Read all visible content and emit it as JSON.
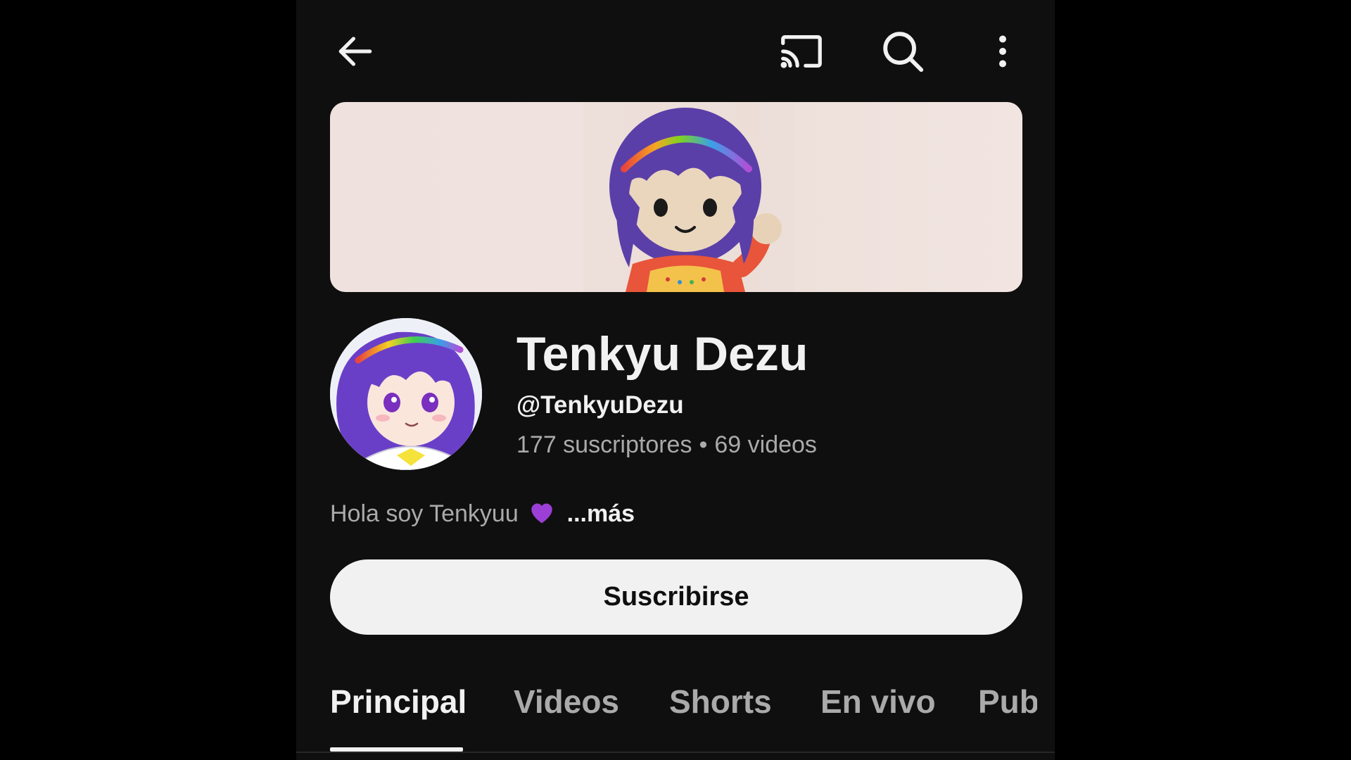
{
  "topbar": {
    "back_icon": "arrow-left-icon",
    "cast_icon": "cast-icon",
    "search_icon": "search-icon",
    "more_icon": "more-vertical-icon"
  },
  "channel": {
    "name": "Tenkyu Dezu",
    "handle": "@TenkyuDezu",
    "subscribers": "177 suscriptores",
    "separator": "•",
    "videos": "69 videos",
    "description": "Hola soy Tenkyuu",
    "description_emoji": "purple-heart-icon",
    "more_label": "...más"
  },
  "subscribe": {
    "label": "Suscribirse"
  },
  "tabs": [
    {
      "label": "Principal",
      "active": true
    },
    {
      "label": "Videos",
      "active": false
    },
    {
      "label": "Shorts",
      "active": false
    },
    {
      "label": "En vivo",
      "active": false
    },
    {
      "label": "Publicaciones",
      "active": false
    }
  ],
  "colors": {
    "background": "#0f0f0f",
    "text_primary": "#f1f1f1",
    "text_secondary": "#aaaaaa",
    "subscribe_bg": "#f1f1f1",
    "heart": "#9b3fd6"
  }
}
